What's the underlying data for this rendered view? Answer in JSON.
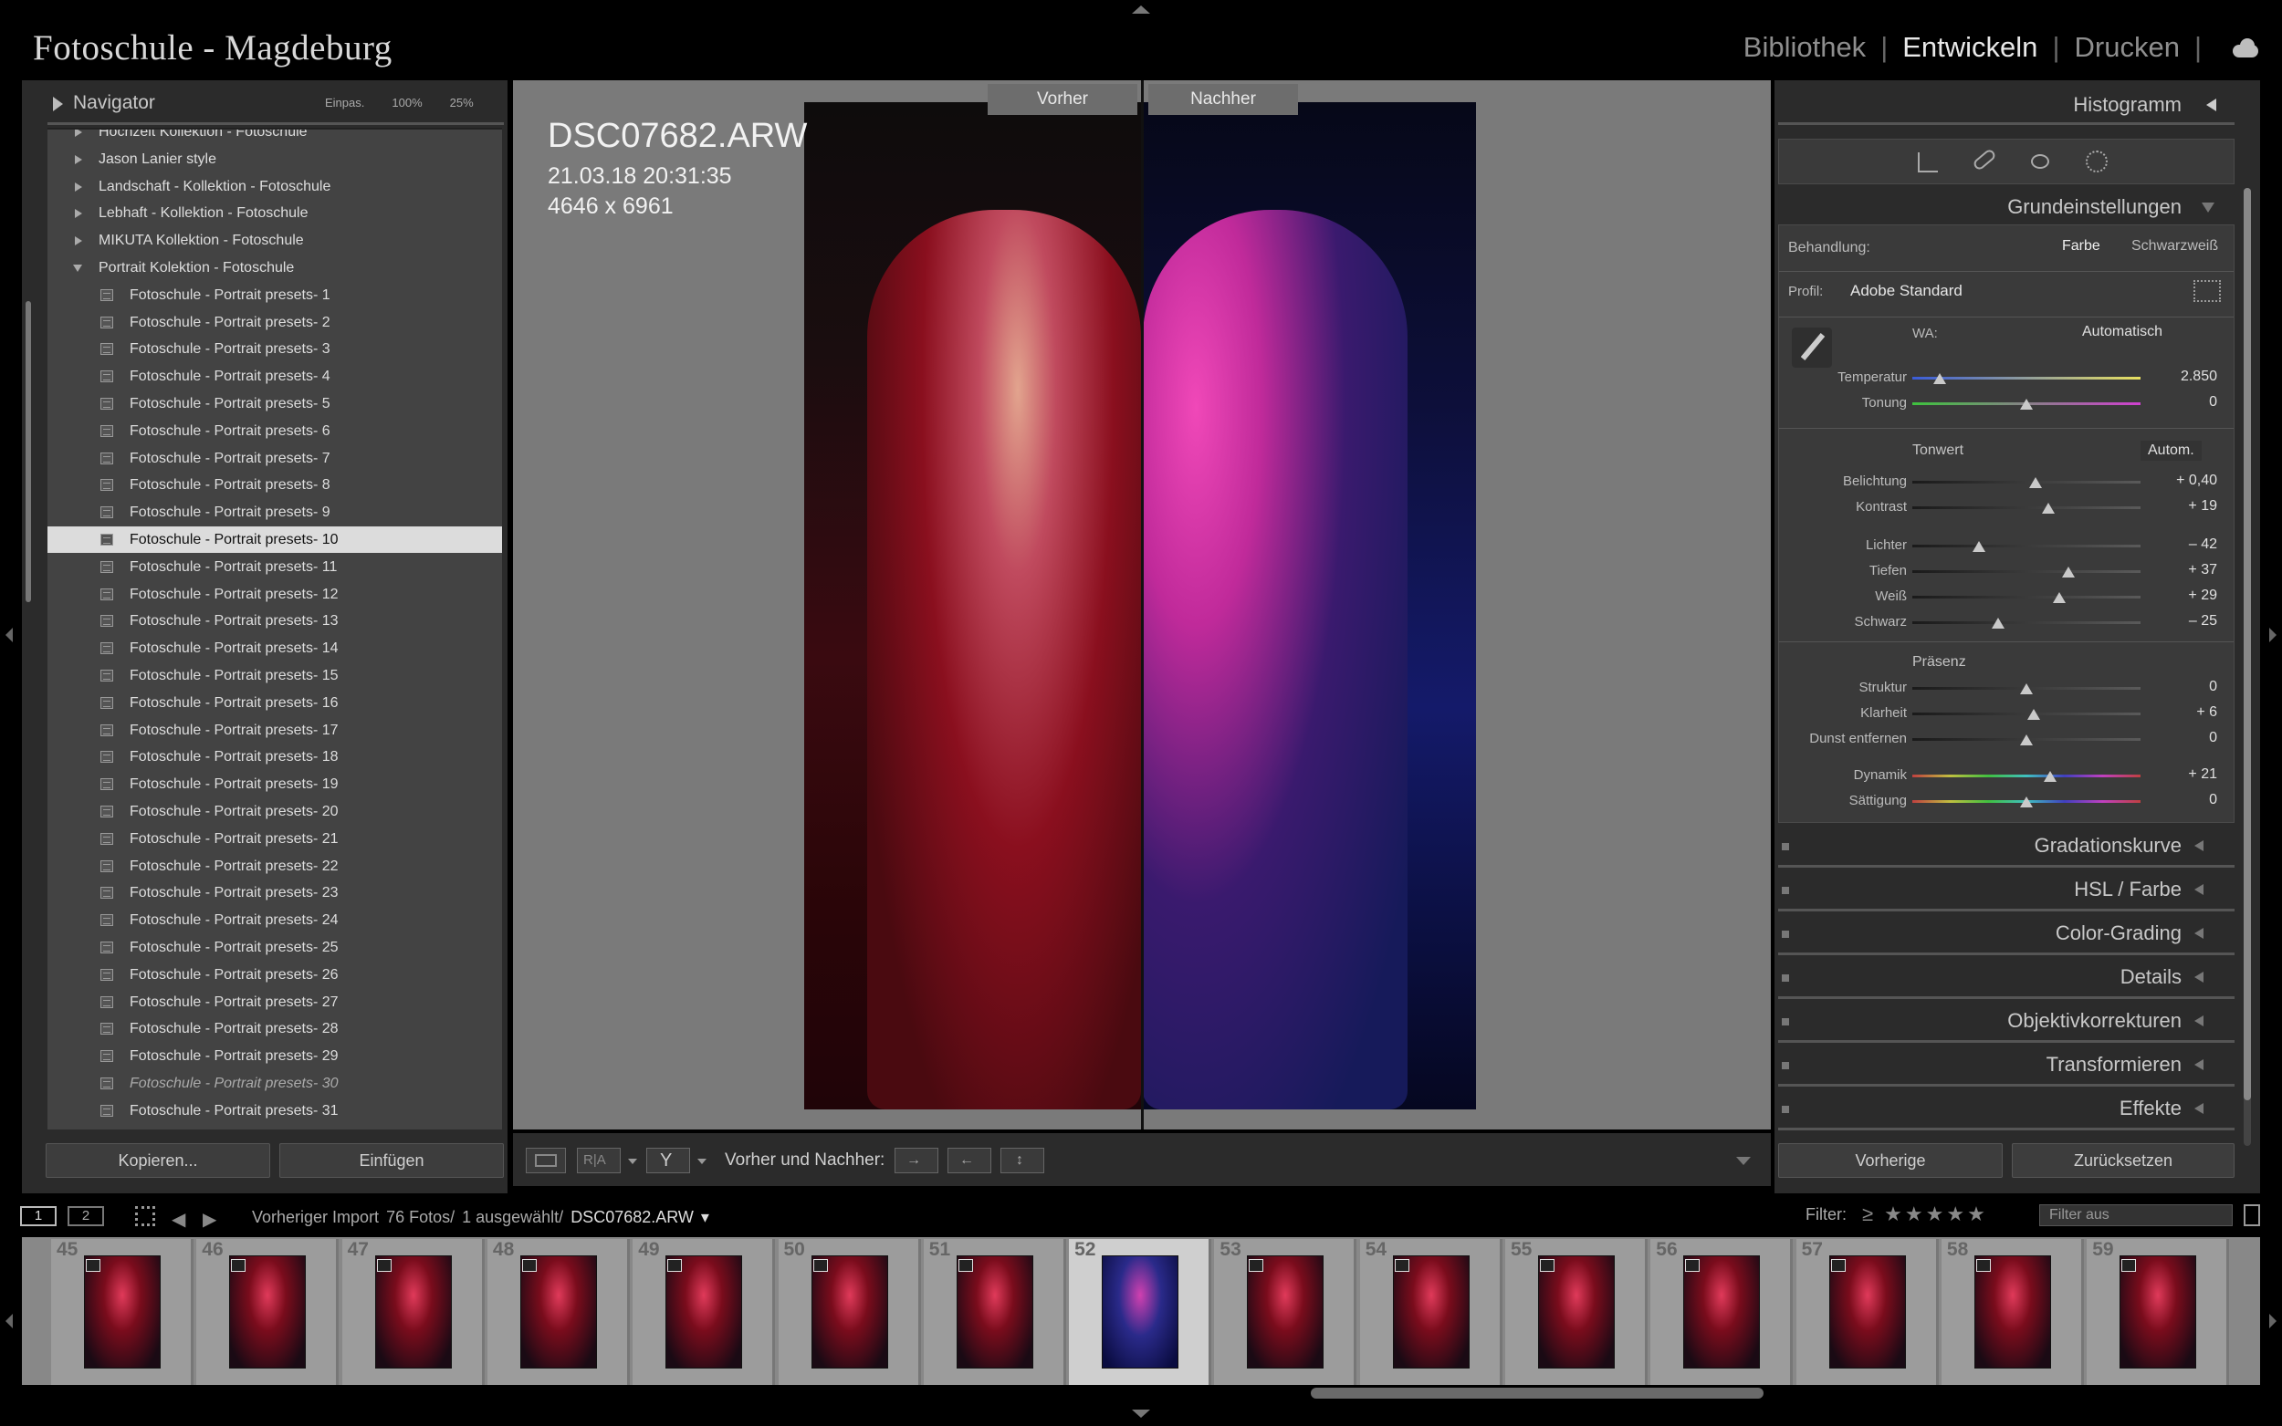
{
  "identity_plate": "Fotoschule - Magdeburg",
  "modules": [
    {
      "label": "Bibliothek",
      "active": false
    },
    {
      "label": "Entwickeln",
      "active": true
    },
    {
      "label": "Drucken",
      "active": false
    }
  ],
  "navigator": {
    "title": "Navigator",
    "zoom_options": [
      "Einpas.",
      "100%",
      "25%"
    ]
  },
  "presets": {
    "items": [
      {
        "label": "Hochzeit Kollektion - Fotoschule",
        "type": "folder"
      },
      {
        "label": "Jason Lanier style",
        "type": "folder"
      },
      {
        "label": "Landschaft - Kollektion - Fotoschule",
        "type": "folder"
      },
      {
        "label": "Lebhaft - Kollektion - Fotoschule",
        "type": "folder"
      },
      {
        "label": "MIKUTA Kollektion - Fotoschule",
        "type": "folder"
      },
      {
        "label": "Portrait Kolektion - Fotoschule",
        "type": "folder-open"
      },
      {
        "label": "Fotoschule - Portrait presets- 1",
        "type": "preset"
      },
      {
        "label": "Fotoschule - Portrait presets- 2",
        "type": "preset"
      },
      {
        "label": "Fotoschule - Portrait presets- 3",
        "type": "preset"
      },
      {
        "label": "Fotoschule - Portrait presets- 4",
        "type": "preset"
      },
      {
        "label": "Fotoschule - Portrait presets- 5",
        "type": "preset"
      },
      {
        "label": "Fotoschule - Portrait presets- 6",
        "type": "preset"
      },
      {
        "label": "Fotoschule - Portrait presets- 7",
        "type": "preset"
      },
      {
        "label": "Fotoschule - Portrait presets- 8",
        "type": "preset"
      },
      {
        "label": "Fotoschule - Portrait presets- 9",
        "type": "preset"
      },
      {
        "label": "Fotoschule - Portrait presets- 10",
        "type": "preset",
        "selected": true
      },
      {
        "label": "Fotoschule - Portrait presets- 11",
        "type": "preset"
      },
      {
        "label": "Fotoschule - Portrait presets- 12",
        "type": "preset"
      },
      {
        "label": "Fotoschule - Portrait presets- 13",
        "type": "preset"
      },
      {
        "label": "Fotoschule - Portrait presets- 14",
        "type": "preset"
      },
      {
        "label": "Fotoschule - Portrait presets- 15",
        "type": "preset"
      },
      {
        "label": "Fotoschule - Portrait presets- 16",
        "type": "preset"
      },
      {
        "label": "Fotoschule - Portrait presets- 17",
        "type": "preset"
      },
      {
        "label": "Fotoschule - Portrait presets- 18",
        "type": "preset"
      },
      {
        "label": "Fotoschule - Portrait presets- 19",
        "type": "preset"
      },
      {
        "label": "Fotoschule - Portrait presets- 20",
        "type": "preset"
      },
      {
        "label": "Fotoschule - Portrait presets- 21",
        "type": "preset"
      },
      {
        "label": "Fotoschule - Portrait presets- 22",
        "type": "preset"
      },
      {
        "label": "Fotoschule - Portrait presets- 23",
        "type": "preset"
      },
      {
        "label": "Fotoschule - Portrait presets- 24",
        "type": "preset"
      },
      {
        "label": "Fotoschule - Portrait presets- 25",
        "type": "preset"
      },
      {
        "label": "Fotoschule - Portrait presets- 26",
        "type": "preset"
      },
      {
        "label": "Fotoschule - Portrait presets- 27",
        "type": "preset"
      },
      {
        "label": "Fotoschule - Portrait presets- 28",
        "type": "preset"
      },
      {
        "label": "Fotoschule - Portrait presets- 29",
        "type": "preset"
      },
      {
        "label": "Fotoschule - Portrait presets- 30",
        "type": "preset",
        "italic": true
      },
      {
        "label": "Fotoschule - Portrait presets- 31",
        "type": "preset"
      }
    ]
  },
  "left_buttons": {
    "copy": "Kopieren...",
    "paste": "Einfügen"
  },
  "image": {
    "filename": "DSC07682.ARW",
    "datetime": "21.03.18 20:31:35",
    "dimensions": "4646 x 6961",
    "before_label": "Vorher",
    "after_label": "Nachher"
  },
  "toolbar": {
    "before_after_label": "Vorher und Nachher:"
  },
  "right": {
    "histogram": "Histogramm",
    "basic": "Grundeinstellungen",
    "treatment": {
      "label": "Behandlung:",
      "color": "Farbe",
      "bw": "Schwarzweiß"
    },
    "profile": {
      "label": "Profil:",
      "value": "Adobe Standard"
    },
    "wb": {
      "label": "WA:",
      "value": "Automatisch"
    },
    "tone_label": "Tonwert",
    "auto": "Autom.",
    "presence_label": "Präsenz",
    "sliders": [
      {
        "label": "Temperatur",
        "value": "2.850",
        "pos": 0.12,
        "track": "temp"
      },
      {
        "label": "Tonung",
        "value": "0",
        "pos": 0.5,
        "track": "tint"
      },
      {
        "label": "Belichtung",
        "value": "+ 0,40",
        "pos": 0.54,
        "track": "gray"
      },
      {
        "label": "Kontrast",
        "value": "+ 19",
        "pos": 0.595,
        "track": "gray"
      },
      {
        "label": "Lichter",
        "value": "– 42",
        "pos": 0.29,
        "track": "gray"
      },
      {
        "label": "Tiefen",
        "value": "+ 37",
        "pos": 0.685,
        "track": "gray"
      },
      {
        "label": "Weiß",
        "value": "+ 29",
        "pos": 0.645,
        "track": "gray"
      },
      {
        "label": "Schwarz",
        "value": "– 25",
        "pos": 0.375,
        "track": "gray"
      },
      {
        "label": "Struktur",
        "value": "0",
        "pos": 0.5,
        "track": "gray"
      },
      {
        "label": "Klarheit",
        "value": "+ 6",
        "pos": 0.53,
        "track": "gray"
      },
      {
        "label": "Dunst entfernen",
        "value": "0",
        "pos": 0.5,
        "track": "gray"
      },
      {
        "label": "Dynamik",
        "value": "+ 21",
        "pos": 0.605,
        "track": "rainbow"
      },
      {
        "label": "Sättigung",
        "value": "0",
        "pos": 0.5,
        "track": "rainbow"
      }
    ],
    "sections": [
      "Gradationskurve",
      "HSL / Farbe",
      "Color-Grading",
      "Details",
      "Objektivkorrekturen",
      "Transformieren",
      "Effekte"
    ],
    "prev_button": "Vorherige",
    "reset_button": "Zurücksetzen"
  },
  "filmstrip": {
    "pages": [
      "1",
      "2"
    ],
    "source": "Vorheriger Import",
    "count": "76 Fotos/",
    "selected_count": "1 ausgewählt/",
    "current_file": "DSC07682.ARW",
    "filter_label": "Filter:",
    "filter_value": "Filter aus",
    "numbers": [
      "45",
      "46",
      "47",
      "48",
      "49",
      "50",
      "51",
      "52",
      "53",
      "54",
      "55",
      "56",
      "57",
      "58",
      "59"
    ],
    "selected_number": "52"
  },
  "colors": {
    "panel": "#2b2b2b",
    "canvas": "#7a7a7a",
    "selected_row": "#dcdcdc",
    "before_tone": "#8a0f1e",
    "after_tone": "#c02a9a"
  }
}
